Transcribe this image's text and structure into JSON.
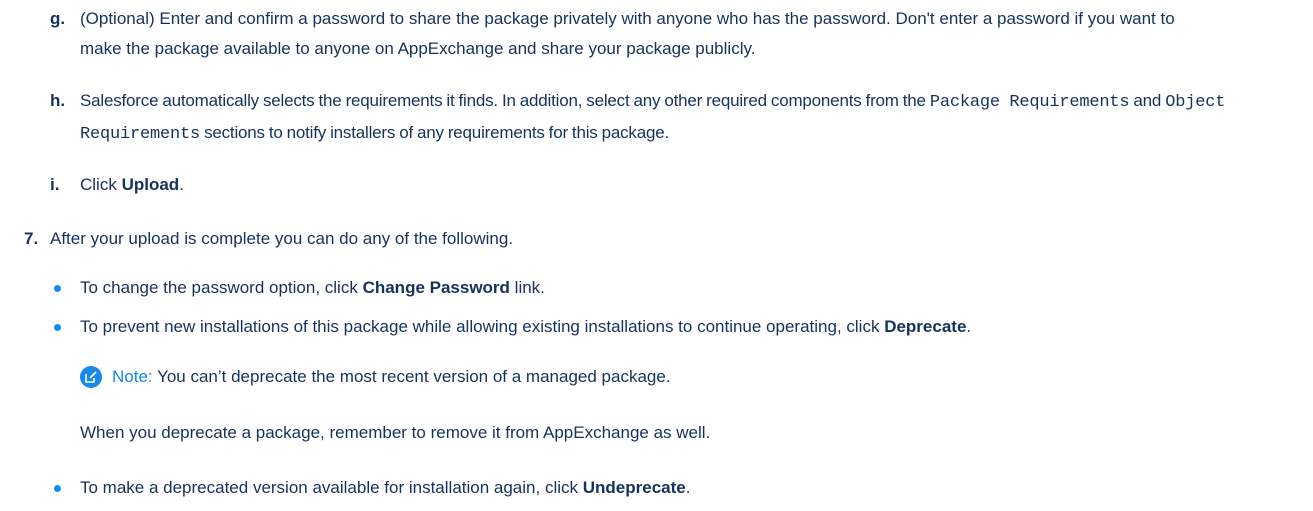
{
  "steps": {
    "g": {
      "marker": "g.",
      "text": "(Optional) Enter and confirm a password to share the package privately with anyone who has the password. Don't enter a password if you want to make the package available to anyone on AppExchange and share your package publicly."
    },
    "h": {
      "marker": "h.",
      "text_before": "Salesforce automatically selects the requirements it finds. In addition, select any other required components from the",
      "code_1": "Package Requirements",
      "text_middle": "and",
      "code_2": "Object Requirements",
      "text_after": "sections to notify installers of any requirements for this package."
    },
    "i": {
      "marker": "i.",
      "text_before": "Click",
      "bold": "Upload",
      "text_after": "."
    },
    "seven": {
      "marker": "7.",
      "text": "After your upload is complete you can do any of the following."
    }
  },
  "bullets": {
    "change_password": {
      "text_before": "To change the password option, click",
      "bold": "Change Password",
      "text_after": "link."
    },
    "deprecate": {
      "text_before": "To prevent new installations of this package while allowing existing installations to continue operating, click",
      "bold": "Deprecate",
      "text_after": "."
    },
    "undeprecate": {
      "text_before": "To make a deprecated version available for installation again, click",
      "bold": "Undeprecate",
      "text_after": "."
    }
  },
  "note": {
    "label": "Note:",
    "text": "You can’t deprecate the most recent version of a managed package.",
    "icon": "note-edit-icon"
  },
  "deprecate_followup": "When you deprecate a package, remember to remove it from AppExchange as well.",
  "colors": {
    "text": "#16325c",
    "accent": "#1589ee"
  }
}
